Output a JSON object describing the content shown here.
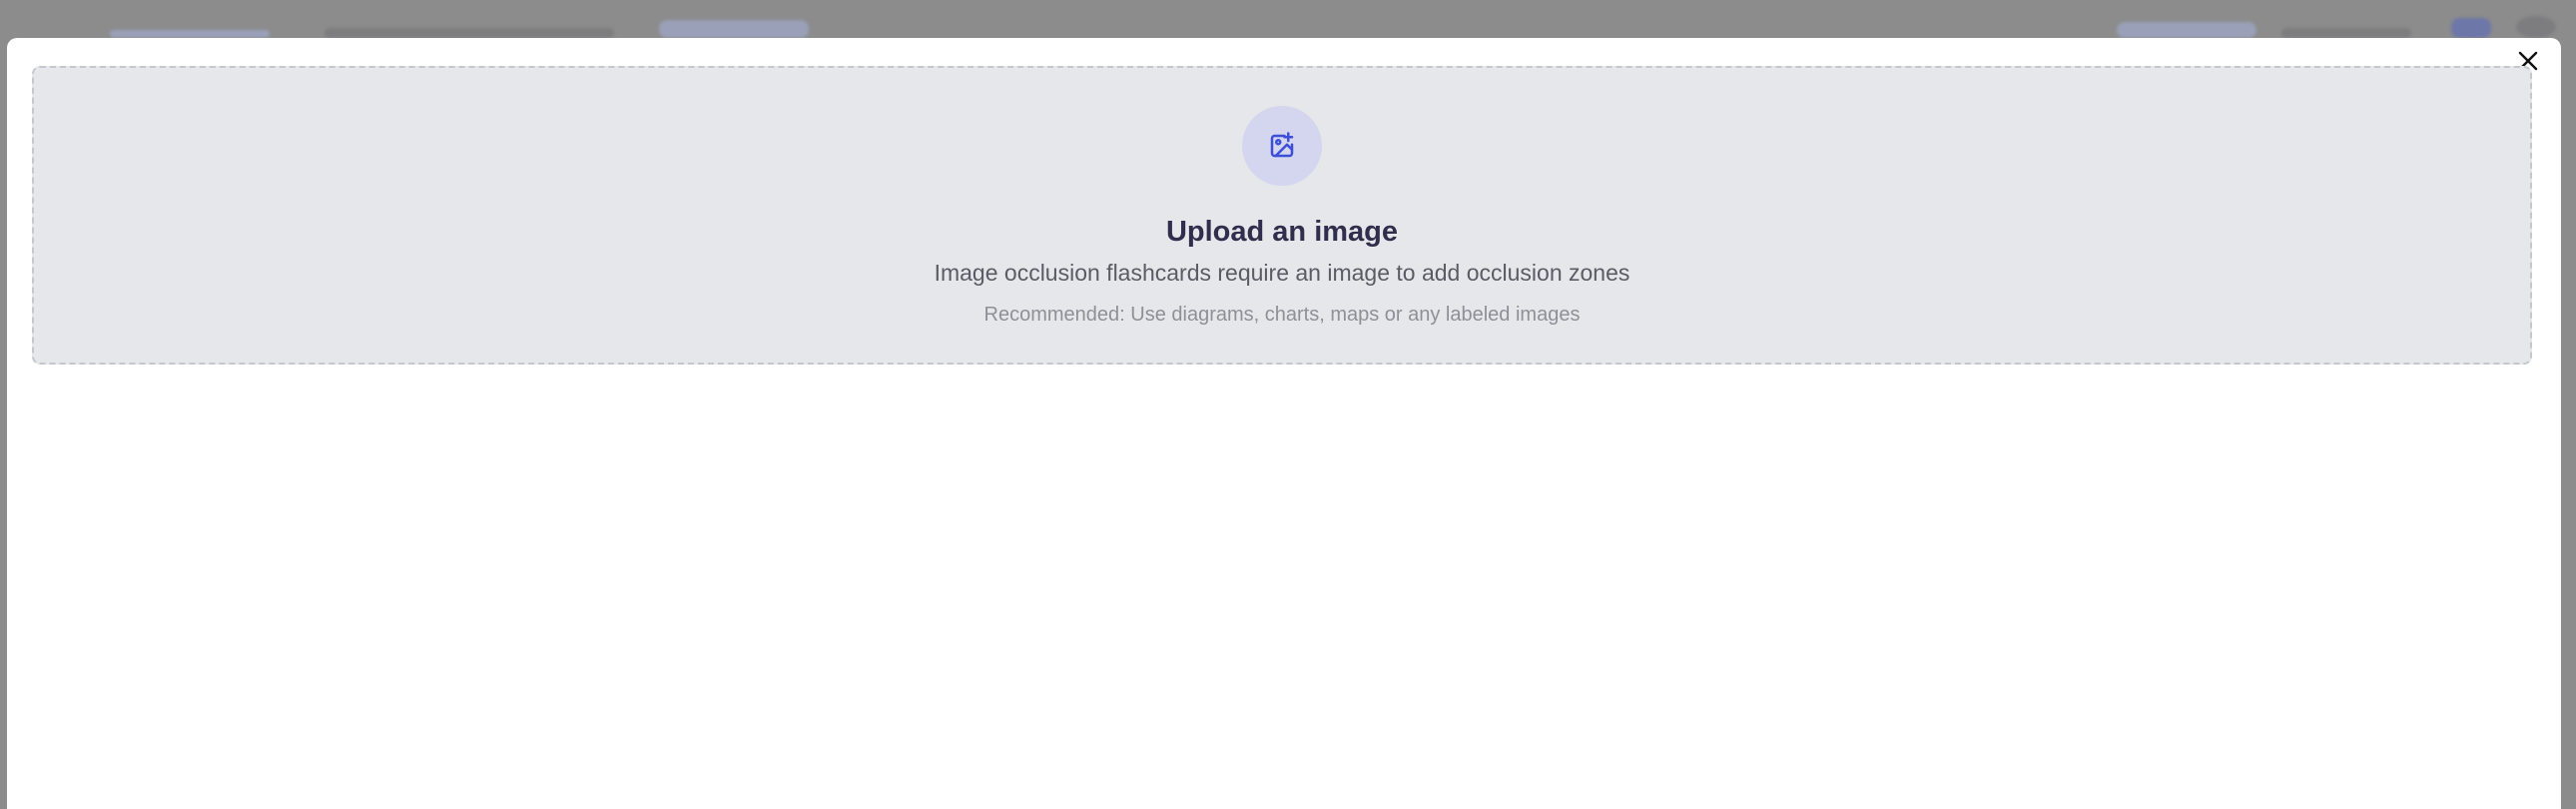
{
  "modal": {
    "close_icon": "close-icon",
    "upload": {
      "icon": "image-add-icon",
      "title": "Upload an image",
      "subtitle": "Image occlusion flashcards require an image to add occlusion zones",
      "hint": "Recommended: Use diagrams, charts, maps or any labeled images"
    }
  },
  "colors": {
    "backdrop": "#8c8c8c",
    "dropzone_bg": "#e6e7ea",
    "icon_circle": "#d3d6ee",
    "accent": "#3d4fd8",
    "title": "#2f2f4d"
  }
}
